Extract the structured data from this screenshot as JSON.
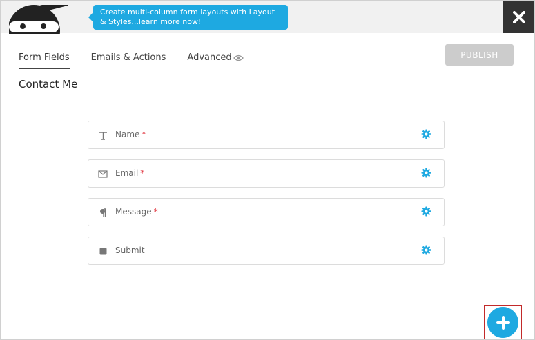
{
  "tooltip": {
    "text": "Create multi-column form layouts with Layout & Styles...learn more now!"
  },
  "header": {
    "logo_icon": "ninja-mascot-icon",
    "close_icon": "close-icon"
  },
  "tabs": [
    {
      "label": "Form Fields",
      "active": true
    },
    {
      "label": "Emails & Actions",
      "active": false
    },
    {
      "label": "Advanced",
      "active": false
    }
  ],
  "preview_icon": "eye-icon",
  "publish_label": "PUBLISH",
  "form_title": "Contact Me",
  "fields": [
    {
      "label": "Name",
      "required": "*",
      "icon": "text-icon"
    },
    {
      "label": "Email",
      "required": "*",
      "icon": "envelope-icon"
    },
    {
      "label": "Message",
      "required": "*",
      "icon": "paragraph-icon"
    },
    {
      "label": "Submit",
      "required": "",
      "icon": "button-icon"
    }
  ],
  "add_button_icon": "plus-icon",
  "colors": {
    "accent": "#1ea9e1",
    "close_bg": "#333333",
    "publish_disabled": "#cccccc",
    "required": "#e0303a",
    "highlight": "#c22a2a"
  }
}
